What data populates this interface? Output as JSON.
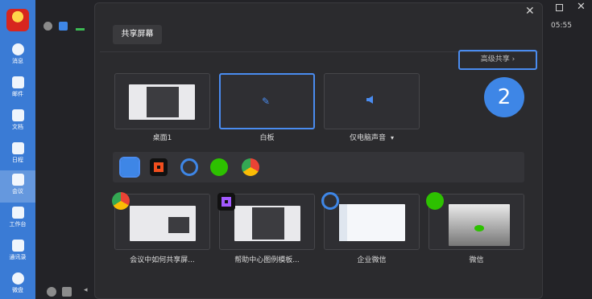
{
  "sidebar": {
    "items": [
      {
        "label": "消息",
        "icon": "chat-bubble-icon"
      },
      {
        "label": "邮件",
        "icon": "mail-icon"
      },
      {
        "label": "文档",
        "icon": "document-icon"
      },
      {
        "label": "日程",
        "icon": "calendar-icon"
      },
      {
        "label": "会议",
        "icon": "meeting-icon",
        "active": true
      },
      {
        "label": "工作台",
        "icon": "grid-icon"
      },
      {
        "label": "通讯录",
        "icon": "org-chart-icon"
      },
      {
        "label": "微盘",
        "icon": "cloud-drive-icon"
      }
    ]
  },
  "meeting": {
    "time": "05:55"
  },
  "dialog": {
    "tab_label": "共享屏幕",
    "advanced_share_label": "高级共享 ›",
    "step_badge": "2",
    "top_cards": [
      {
        "label": "桌面1",
        "icon": "desktop-thumbnail"
      },
      {
        "label": "白板",
        "icon": "pen-icon",
        "selected": true
      },
      {
        "label": "仅电脑声音",
        "icon": "speaker-icon",
        "dropdown": "▾"
      }
    ],
    "filters": [
      {
        "name": "all-apps",
        "icon": "grid-icon",
        "selected": true
      },
      {
        "name": "figma",
        "icon": "figma-icon"
      },
      {
        "name": "wecom",
        "icon": "wecom-icon"
      },
      {
        "name": "wechat",
        "icon": "wechat-icon"
      },
      {
        "name": "chrome",
        "icon": "chrome-icon"
      }
    ],
    "windows": [
      {
        "label": "会议中如何共享屏...",
        "app_icon": "chrome-icon"
      },
      {
        "label": "帮助中心图例模板...",
        "app_icon": "figma-icon"
      },
      {
        "label": "企业微信",
        "app_icon": "wecom-icon"
      },
      {
        "label": "微信",
        "app_icon": "wechat-icon"
      }
    ]
  },
  "colors": {
    "accent": "#4a8cf0",
    "sidebar": "#3a7bd5",
    "badge": "#3e86e6"
  }
}
